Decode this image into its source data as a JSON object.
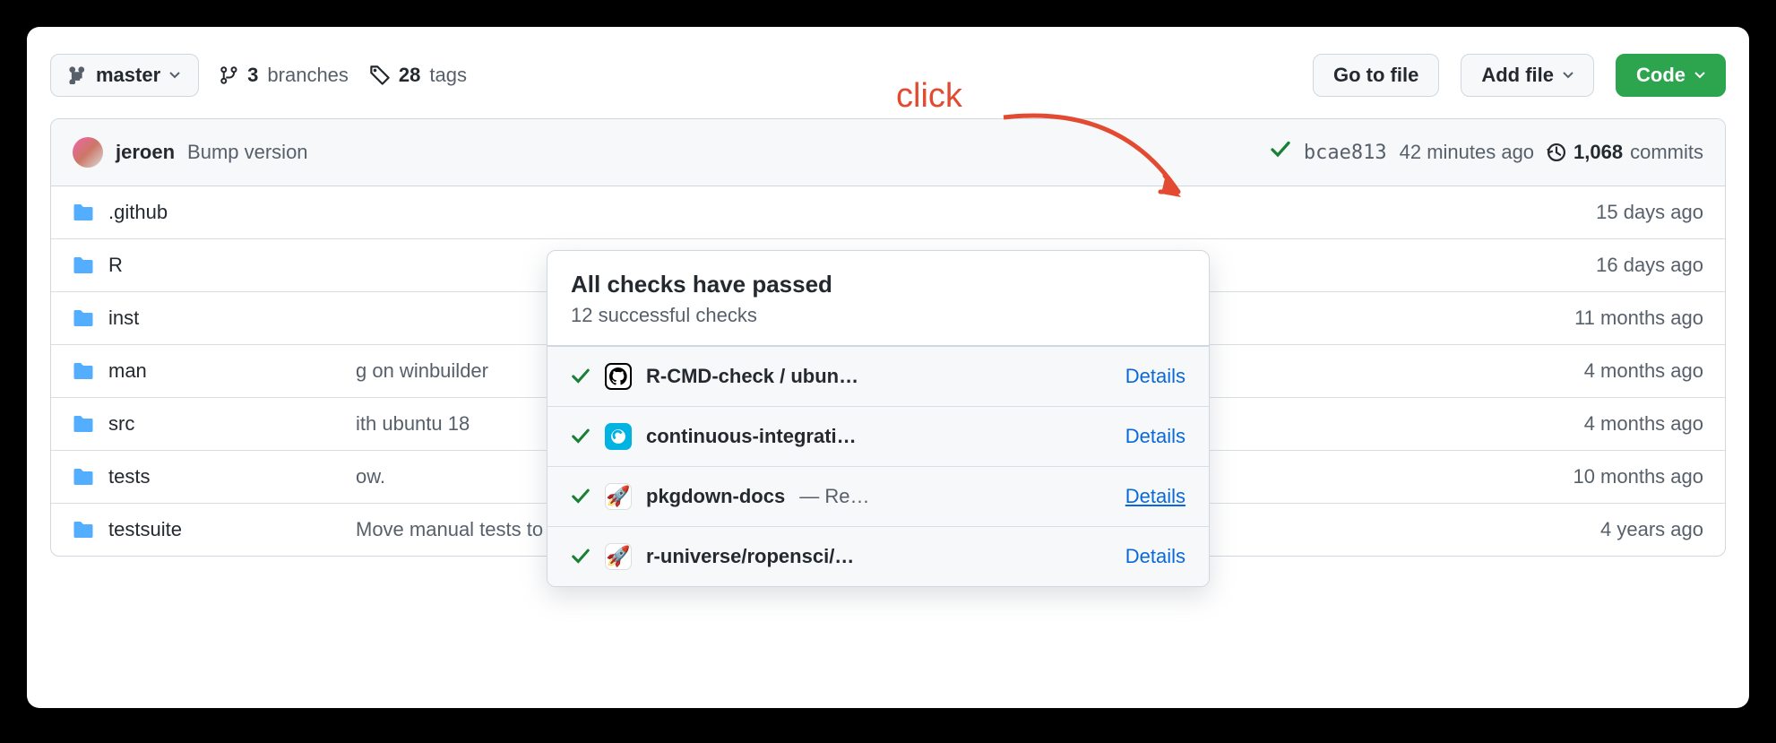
{
  "annotation": {
    "label": "click"
  },
  "topbar": {
    "branch": "master",
    "branches_count": "3",
    "branches_label": "branches",
    "tags_count": "28",
    "tags_label": "tags",
    "goto_file": "Go to file",
    "add_file": "Add file",
    "code": "Code"
  },
  "latest": {
    "author": "jeroen",
    "message": "Bump version",
    "sha": "bcae813",
    "ago": "42 minutes ago",
    "commits_count": "1,068",
    "commits_label": "commits"
  },
  "popover": {
    "title": "All checks have passed",
    "subtitle": "12 successful checks",
    "checks": [
      {
        "name": "R-CMD-check / ubun…",
        "extra": "",
        "logo": "github",
        "details": "Details",
        "underline": false
      },
      {
        "name": "continuous-integrati…",
        "extra": "",
        "logo": "appveyor",
        "details": "Details",
        "underline": false
      },
      {
        "name": "pkgdown-docs",
        "extra": " — Re…",
        "logo": "rocket",
        "details": "Details",
        "underline": true
      },
      {
        "name": "r-universe/ropensci/…",
        "extra": "",
        "logo": "rocket",
        "details": "Details",
        "underline": false
      }
    ]
  },
  "files": [
    {
      "name": ".github",
      "msg": "",
      "ago": "15 days ago"
    },
    {
      "name": "R",
      "msg": "",
      "ago": "16 days ago"
    },
    {
      "name": "inst",
      "msg": "",
      "ago": "11 months ago"
    },
    {
      "name": "man",
      "msg": "g on winbuilder",
      "ago": "4 months ago"
    },
    {
      "name": "src",
      "msg": "ith ubuntu 18",
      "ago": "4 months ago"
    },
    {
      "name": "tests",
      "msg": "ow.",
      "ago": "10 months ago"
    },
    {
      "name": "testsuite",
      "msg": "Move manual tests to another dir",
      "ago": "4 years ago"
    }
  ]
}
